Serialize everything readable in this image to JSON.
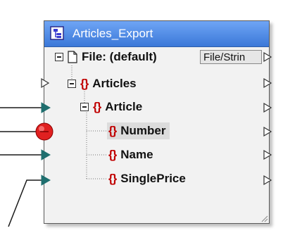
{
  "component": {
    "title": "Articles_Export",
    "file_label": "File: (default)",
    "file_button": "File/Strin",
    "nodes": [
      {
        "label": "Articles",
        "selected": false
      },
      {
        "label": "Article",
        "selected": false
      },
      {
        "label": "Number",
        "selected": true
      },
      {
        "label": "Name",
        "selected": false
      },
      {
        "label": "SinglePrice",
        "selected": false
      }
    ]
  },
  "colors": {
    "title_bar": "#4a86e8",
    "element_brace": "#c00000",
    "connection_arrow": "#1f6f6f",
    "error_marker": "#e02020"
  },
  "icons": [
    "component-icon",
    "file-icon",
    "expand-collapse-icon",
    "element-icon",
    "input-arrow-icon",
    "output-arrow-icon",
    "error-marker-icon",
    "resize-grip-icon"
  ]
}
